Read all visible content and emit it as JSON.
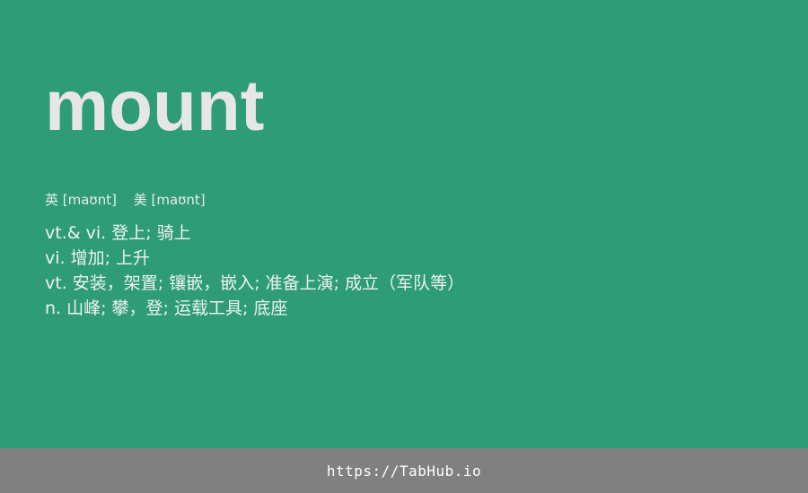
{
  "entry": {
    "word": "mount",
    "phonetics": {
      "uk": "英 [maʊnt]",
      "us": "美 [maʊnt]"
    },
    "definitions": [
      "vt.& vi. 登上; 骑上",
      "vi. 增加; 上升",
      "vt. 安装，架置; 镶嵌，嵌入; 准备上演; 成立（军队等）",
      "n. 山峰; 攀，登; 运载工具; 底座"
    ]
  },
  "footer": {
    "link": "https://TabHub.io"
  },
  "colors": {
    "background": "#2e9c76",
    "footer": "#808080",
    "word": "#e6e6e6"
  }
}
